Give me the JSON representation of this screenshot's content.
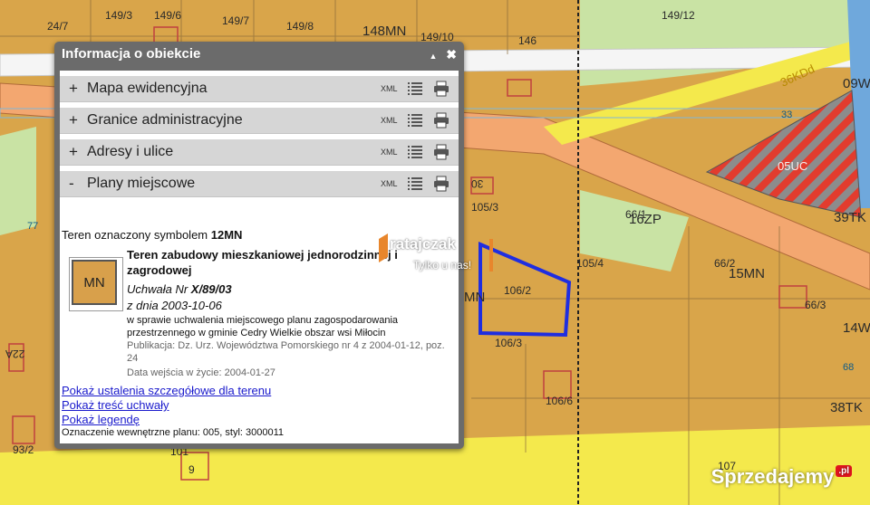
{
  "map": {
    "labels": [
      "24/7",
      "149/3",
      "149/6",
      "149/7",
      "149/8",
      "148MN",
      "149/10",
      "149/12",
      "146",
      "36KDd",
      "33",
      "09W",
      "05UC",
      "39TK",
      "105/3",
      "105/4",
      "66/1",
      "16ZP",
      "66/2",
      "15MN",
      "66/3",
      "14W",
      "106/2",
      "106/3",
      "MN",
      "106/6",
      "38TK",
      "68",
      "107",
      "93/2",
      "101",
      "9",
      "77",
      "22A",
      "30"
    ],
    "colors": {
      "parcel": "#d9a54a",
      "green": "#c9e3a4",
      "road": "#f3a770",
      "yellow": "#f4e94c",
      "blue_outline": "#1f2ee0",
      "water": "#6fa8dc"
    }
  },
  "panel": {
    "title": "Informacja o obiekcie",
    "controls": {
      "collapse": "▲",
      "close": "✖"
    },
    "sections": [
      {
        "sign": "+",
        "title": "Mapa ewidencyjna",
        "xml": "XML"
      },
      {
        "sign": "+",
        "title": "Granice administracyjne",
        "xml": "XML"
      },
      {
        "sign": "+",
        "title": "Adresy i ulice",
        "xml": "XML"
      },
      {
        "sign": "-",
        "title": "Plany miejscowe",
        "xml": "XML"
      }
    ],
    "plan": {
      "symbol_line_prefix": "Teren oznaczony symbolem ",
      "symbol": "12MN",
      "box_label": "MN",
      "heading_1": "Teren zabudowy mieszkaniowej jednorodzinnej i",
      "heading_2": "zagrodowej",
      "uchwala_prefix": "Uchwała Nr ",
      "uchwala_nr": "X/89/03",
      "date": "z dnia 2003-10-06",
      "desc_1": "w sprawie uchwalenia miejscowego planu zagospodarowania",
      "desc_2": "przestrzennego w gminie Cedry Wielkie obszar wsi Miłocin",
      "publ_1": "Publikacja: Dz. Urz. Województwa Pomorskiego nr 4 z 2004-01-12, poz.",
      "publ_2": "24",
      "effective": "Data wejścia w życie: 2004-01-27",
      "links": [
        "Pokaż ustalenia szczegółowe dla terenu",
        "Pokaż treść uchwały",
        "Pokaż legendę"
      ],
      "internal": "Oznaczenie wewnętrzne planu: 005, styl: 3000011"
    }
  },
  "watermark": {
    "name": "ratajczak",
    "tagline": "Tylko u nas!"
  },
  "brand": {
    "name": "Sprzedajemy",
    "suffix": ".pl"
  }
}
